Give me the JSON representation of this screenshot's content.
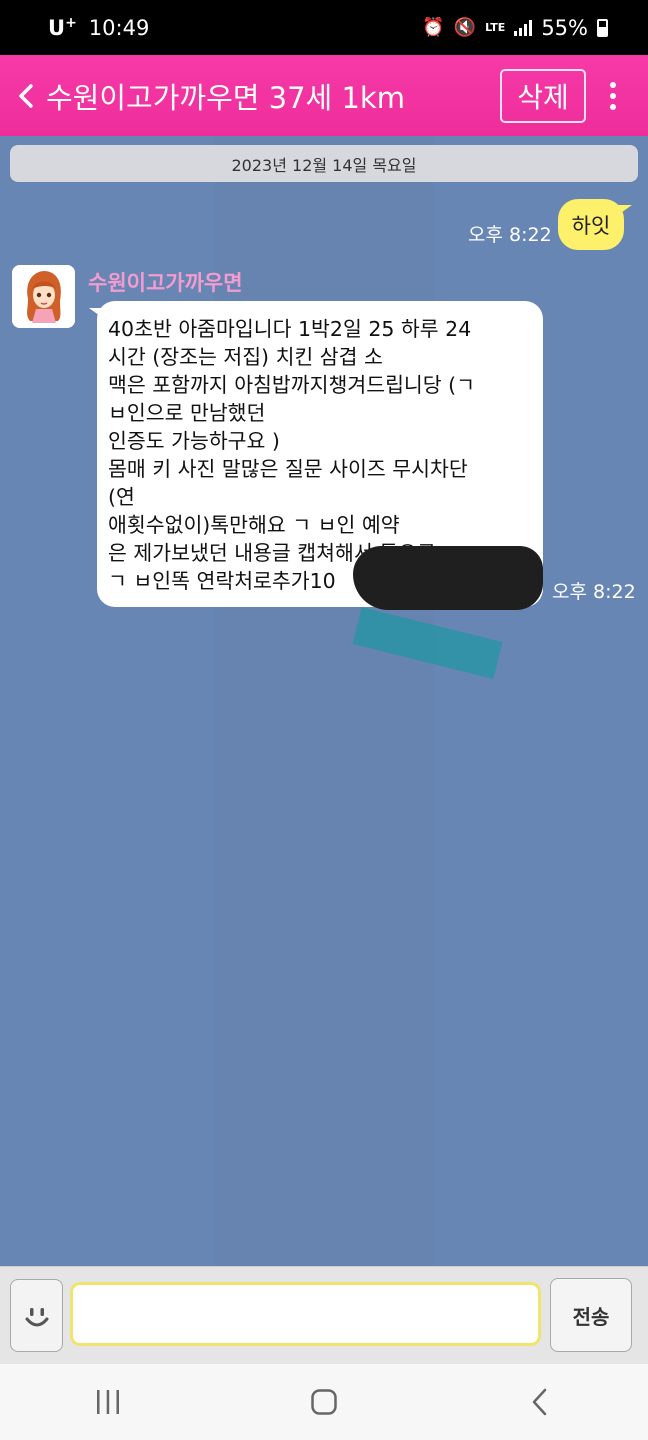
{
  "status_bar": {
    "carrier": "U",
    "carrier_sup": "+",
    "time": "10:49",
    "network": "LTE",
    "battery": "55%"
  },
  "header": {
    "title": "수원이고가까우면 37세 1km",
    "delete_label": "삭제",
    "accent_color": "#f63aa8"
  },
  "chat": {
    "date": "2023년 12월 14일 목요일",
    "messages": [
      {
        "direction": "out",
        "text": "하잇",
        "time": "오후 8:22"
      },
      {
        "direction": "in",
        "sender": "수원이고가까우면",
        "lines": [
          "40초반 아줌마입니다 1박2일 25 하루 24",
          "시간 (장조는 저집) 치킨 삼겹 소",
          "맥은 포함까지 아침밥까지챙겨드립니당 (ㄱ",
          "ㅂ인으로 만남했던",
          "인증도 가능하구요 )",
          "몸매 키 사진 말많은 질문 사이즈 무시차단",
          "(연",
          "애횟수없이)톡만해요  ㄱ ㅂ인 예약",
          "은 제가보냈던 내용글 캡쳐해서 등으로",
          "ㄱ ㅂ인똑 연락처로추가10"
        ],
        "time": "오후 8:22"
      }
    ]
  },
  "input": {
    "value": "",
    "placeholder": "",
    "send_label": "전송"
  },
  "icons": {
    "back": "chevron-left-icon",
    "menu": "more-vert-icon",
    "emoji": "smiley-icon",
    "nav_recents": "recents-icon",
    "nav_home": "home-icon",
    "nav_back": "back-icon"
  }
}
